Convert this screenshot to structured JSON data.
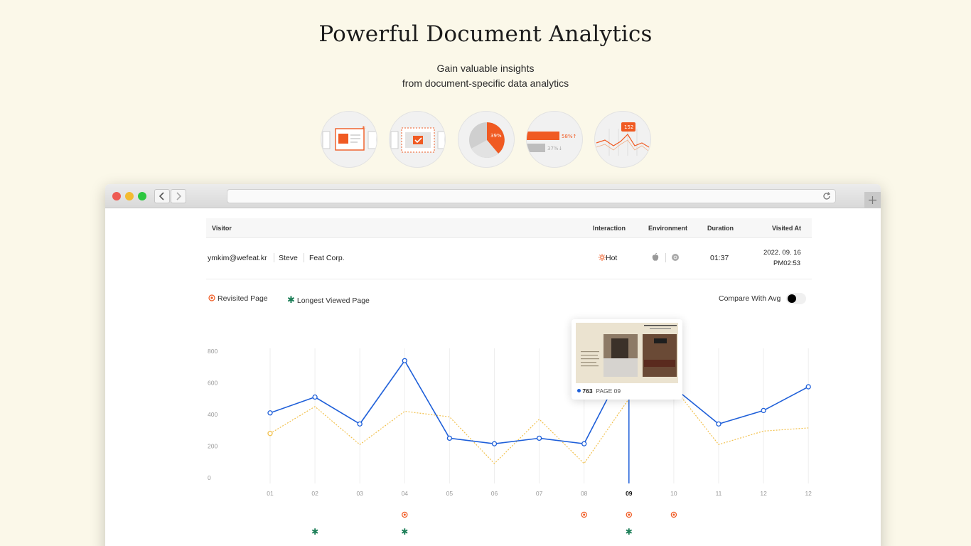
{
  "hero": {
    "title": "Powerful Document Analytics",
    "subtitle_line1": "Gain valuable insights",
    "subtitle_line2": "from document-specific data analytics"
  },
  "features": [
    {
      "icon": "slide-highlight-icon"
    },
    {
      "icon": "page-check-icon"
    },
    {
      "icon": "pie-chart-icon",
      "label": "39%"
    },
    {
      "icon": "bar-compare-icon",
      "label_up": "58%↑",
      "label_down": "37%↓"
    },
    {
      "icon": "line-chart-icon",
      "label": "152"
    }
  ],
  "table": {
    "columns": [
      "Visitor",
      "Interaction",
      "Environment",
      "Duration",
      "Visited At"
    ],
    "row": {
      "email": "ymkim@wefeat.kr",
      "name": "Steve",
      "company": "Feat Corp.",
      "interaction": "Hot",
      "environment_icons": [
        "apple-icon",
        "chrome-icon"
      ],
      "duration": "01:37",
      "visited_date": "2022. 09. 16",
      "visited_time": "PM02:53"
    }
  },
  "legend": {
    "revisited": "Revisited Page",
    "longest": "Longest Viewed Page",
    "compare": "Compare With Avg",
    "compare_on": true
  },
  "colors": {
    "accent": "#f05a22",
    "series_main": "#1e5fd9",
    "series_avg": "#f2c14e",
    "longest": "#1a7d56",
    "background": "#fbf8e9"
  },
  "tooltip": {
    "value": "763",
    "page": "PAGE 09"
  },
  "chart_data": {
    "type": "line",
    "categories": [
      "01",
      "02",
      "03",
      "04",
      "05",
      "06",
      "07",
      "08",
      "09",
      "10",
      "11",
      "12",
      "12"
    ],
    "highlight_category": "09",
    "ylim": [
      0,
      800
    ],
    "yticks": [
      0,
      200,
      400,
      600,
      800
    ],
    "series": [
      {
        "values": [
          410,
          510,
          340,
          740,
          250,
          215,
          250,
          215,
          763,
          570,
          340,
          425,
          575
        ]
      },
      {
        "values": [
          280,
          450,
          210,
          420,
          385,
          90,
          370,
          90,
          500,
          570,
          210,
          295,
          315
        ]
      }
    ],
    "revisited_pages": [
      "04",
      "08",
      "09",
      "10"
    ],
    "longest_viewed_pages": [
      "02",
      "04",
      "09"
    ]
  }
}
